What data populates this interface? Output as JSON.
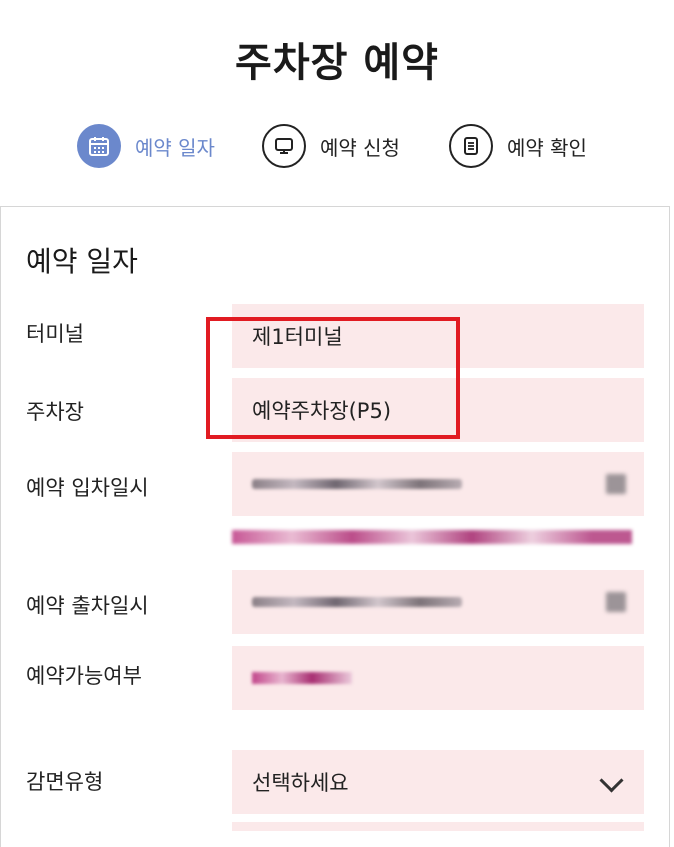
{
  "page": {
    "title": "주차장 예약"
  },
  "steps": [
    {
      "label": "예약 일자",
      "icon": "calendar-icon",
      "active": true
    },
    {
      "label": "예약 신청",
      "icon": "monitor-icon",
      "active": false
    },
    {
      "label": "예약 확인",
      "icon": "document-icon",
      "active": false
    }
  ],
  "form": {
    "section_title": "예약 일자",
    "terminal": {
      "label": "터미널",
      "value": "제1터미널"
    },
    "parking": {
      "label": "주차장",
      "value": "예약주차장(P5)"
    },
    "entry_datetime": {
      "label": "예약 입차일시"
    },
    "exit_datetime": {
      "label": "예약 출차일시"
    },
    "availability": {
      "label": "예약가능여부"
    },
    "discount_type": {
      "label": "감면유형",
      "value": "선택하세요"
    }
  },
  "colors": {
    "accent": "#6b88cc",
    "field_bg": "#fbe9ea",
    "highlight": "#e11b22"
  }
}
